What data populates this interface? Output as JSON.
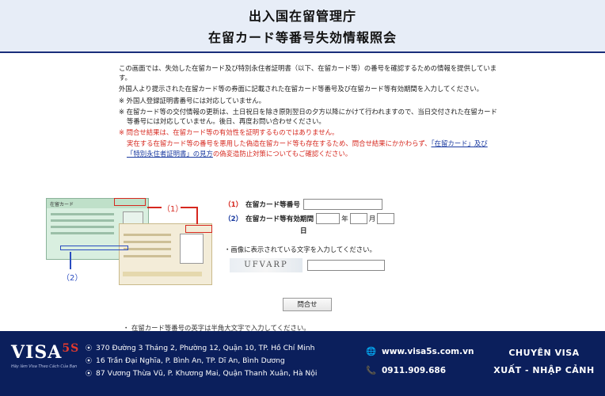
{
  "header": {
    "title": "出入国在留管理庁",
    "subtitle": "在留カード等番号失効情報照会"
  },
  "intro": {
    "p1": "この画面では、失効した在留カード及び特別永住者証明書（以下、在留カード等）の番号を確認するための情報を提供しています。",
    "p2": "外国人より提示された在留カード等の券面に記載された在留カード等番号及び在留カード等有効期間を入力してください。",
    "note1": "※ 外国人登録証明書番号には対応していません。",
    "note2": "※ 在留カード等の交付情報の更新は、土日祝日を除き原則翌日の夕方以降にかけて行われますので、当日交付された在留カード等番号には対応していません。後日、再度お問い合わせください。",
    "warn1": "※ 問合せ結果は、在留カード等の有効性を証明するものではありません。",
    "warn2_pre": "実在する在留カード等の番号を悪用した偽造在留カード等も存在するため、問合せ結果にかかわらず、",
    "warn2_link": "「在留カード」及び「特別永住者証明書」の見方",
    "warn2_post": "の偽変造防止対策についてもご確認ください。"
  },
  "card_image": {
    "marker1": "（1）",
    "marker2": "（2）",
    "card1_head": "在留カード"
  },
  "form": {
    "field1_num": "（1）",
    "field1_label": "在留カード等番号",
    "field2_num": "（2）",
    "field2_label": "在留カード等有効期間",
    "year": "年",
    "month": "月",
    "day": "日",
    "captcha_instruction": "・画像に表示されている文字を入力してください。",
    "captcha_text": "UFVARP",
    "submit_label": "問合せ",
    "bottom_note": "・ 在留カード等番号の英字は半角大文字で入力してください。"
  },
  "footer": {
    "logo_text": "VISA",
    "logo_suffix": "5S",
    "logo_tagline": "Hãy làm Visa Theo Cách Của Bạn",
    "addresses": [
      "370 Đường 3 Tháng 2, Phường 12, Quận 10, TP. Hồ Chí Minh",
      "16 Trần Đại Nghĩa, P. Bình An, TP. Dĩ An, Bình Dương",
      "87 Vương Thừa Vũ, P. Khương Mai, Quận Thanh Xuân, Hà Nội"
    ],
    "website": "www.visa5s.com.vn",
    "phone": "0911.909.686",
    "service_line1": "CHUYÊN VISA",
    "service_line2": "XUẤT - NHẬP CẢNH",
    "colors": {
      "background": "#0b1f5c",
      "accent": "#e23a2e"
    }
  }
}
